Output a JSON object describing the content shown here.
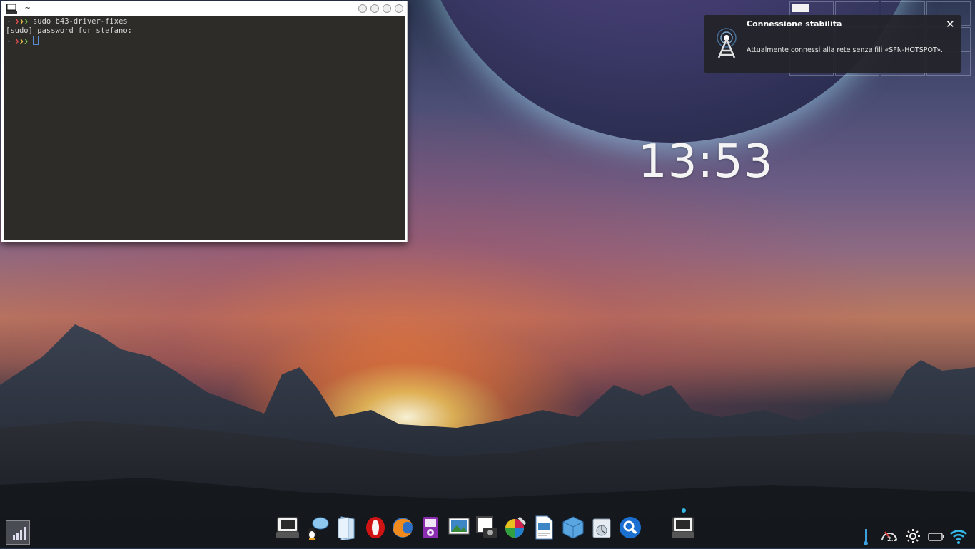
{
  "desktop": {
    "clock": "13:53"
  },
  "terminal": {
    "title": "~",
    "lines": {
      "line1_prompt": "~ ",
      "line1_command": " sudo b43-driver-fixes",
      "line2": "[sudo] password for stefano:",
      "line3_prompt": "~ "
    }
  },
  "notification": {
    "title": "Connessione stabilita",
    "body": "Attualmente connessi alla rete senza fili «SFN-HOTSPOT».",
    "close_label": "✕"
  },
  "dock": {
    "items": [
      "terminal-icon",
      "pidgin-icon",
      "files-icon",
      "opera-icon",
      "firefox-icon",
      "music-player-icon",
      "image-viewer-icon",
      "screenshot-icon",
      "color-picker-icon",
      "document-viewer-icon",
      "virtualbox-icon",
      "settings-icon",
      "search-icon",
      "terminal-icon"
    ]
  },
  "tray": {
    "cpu_value": "2.2"
  },
  "colors": {
    "accent": "#32b8e6",
    "terminal_bg": "#2d2c29",
    "notification_bg": "#232328"
  }
}
